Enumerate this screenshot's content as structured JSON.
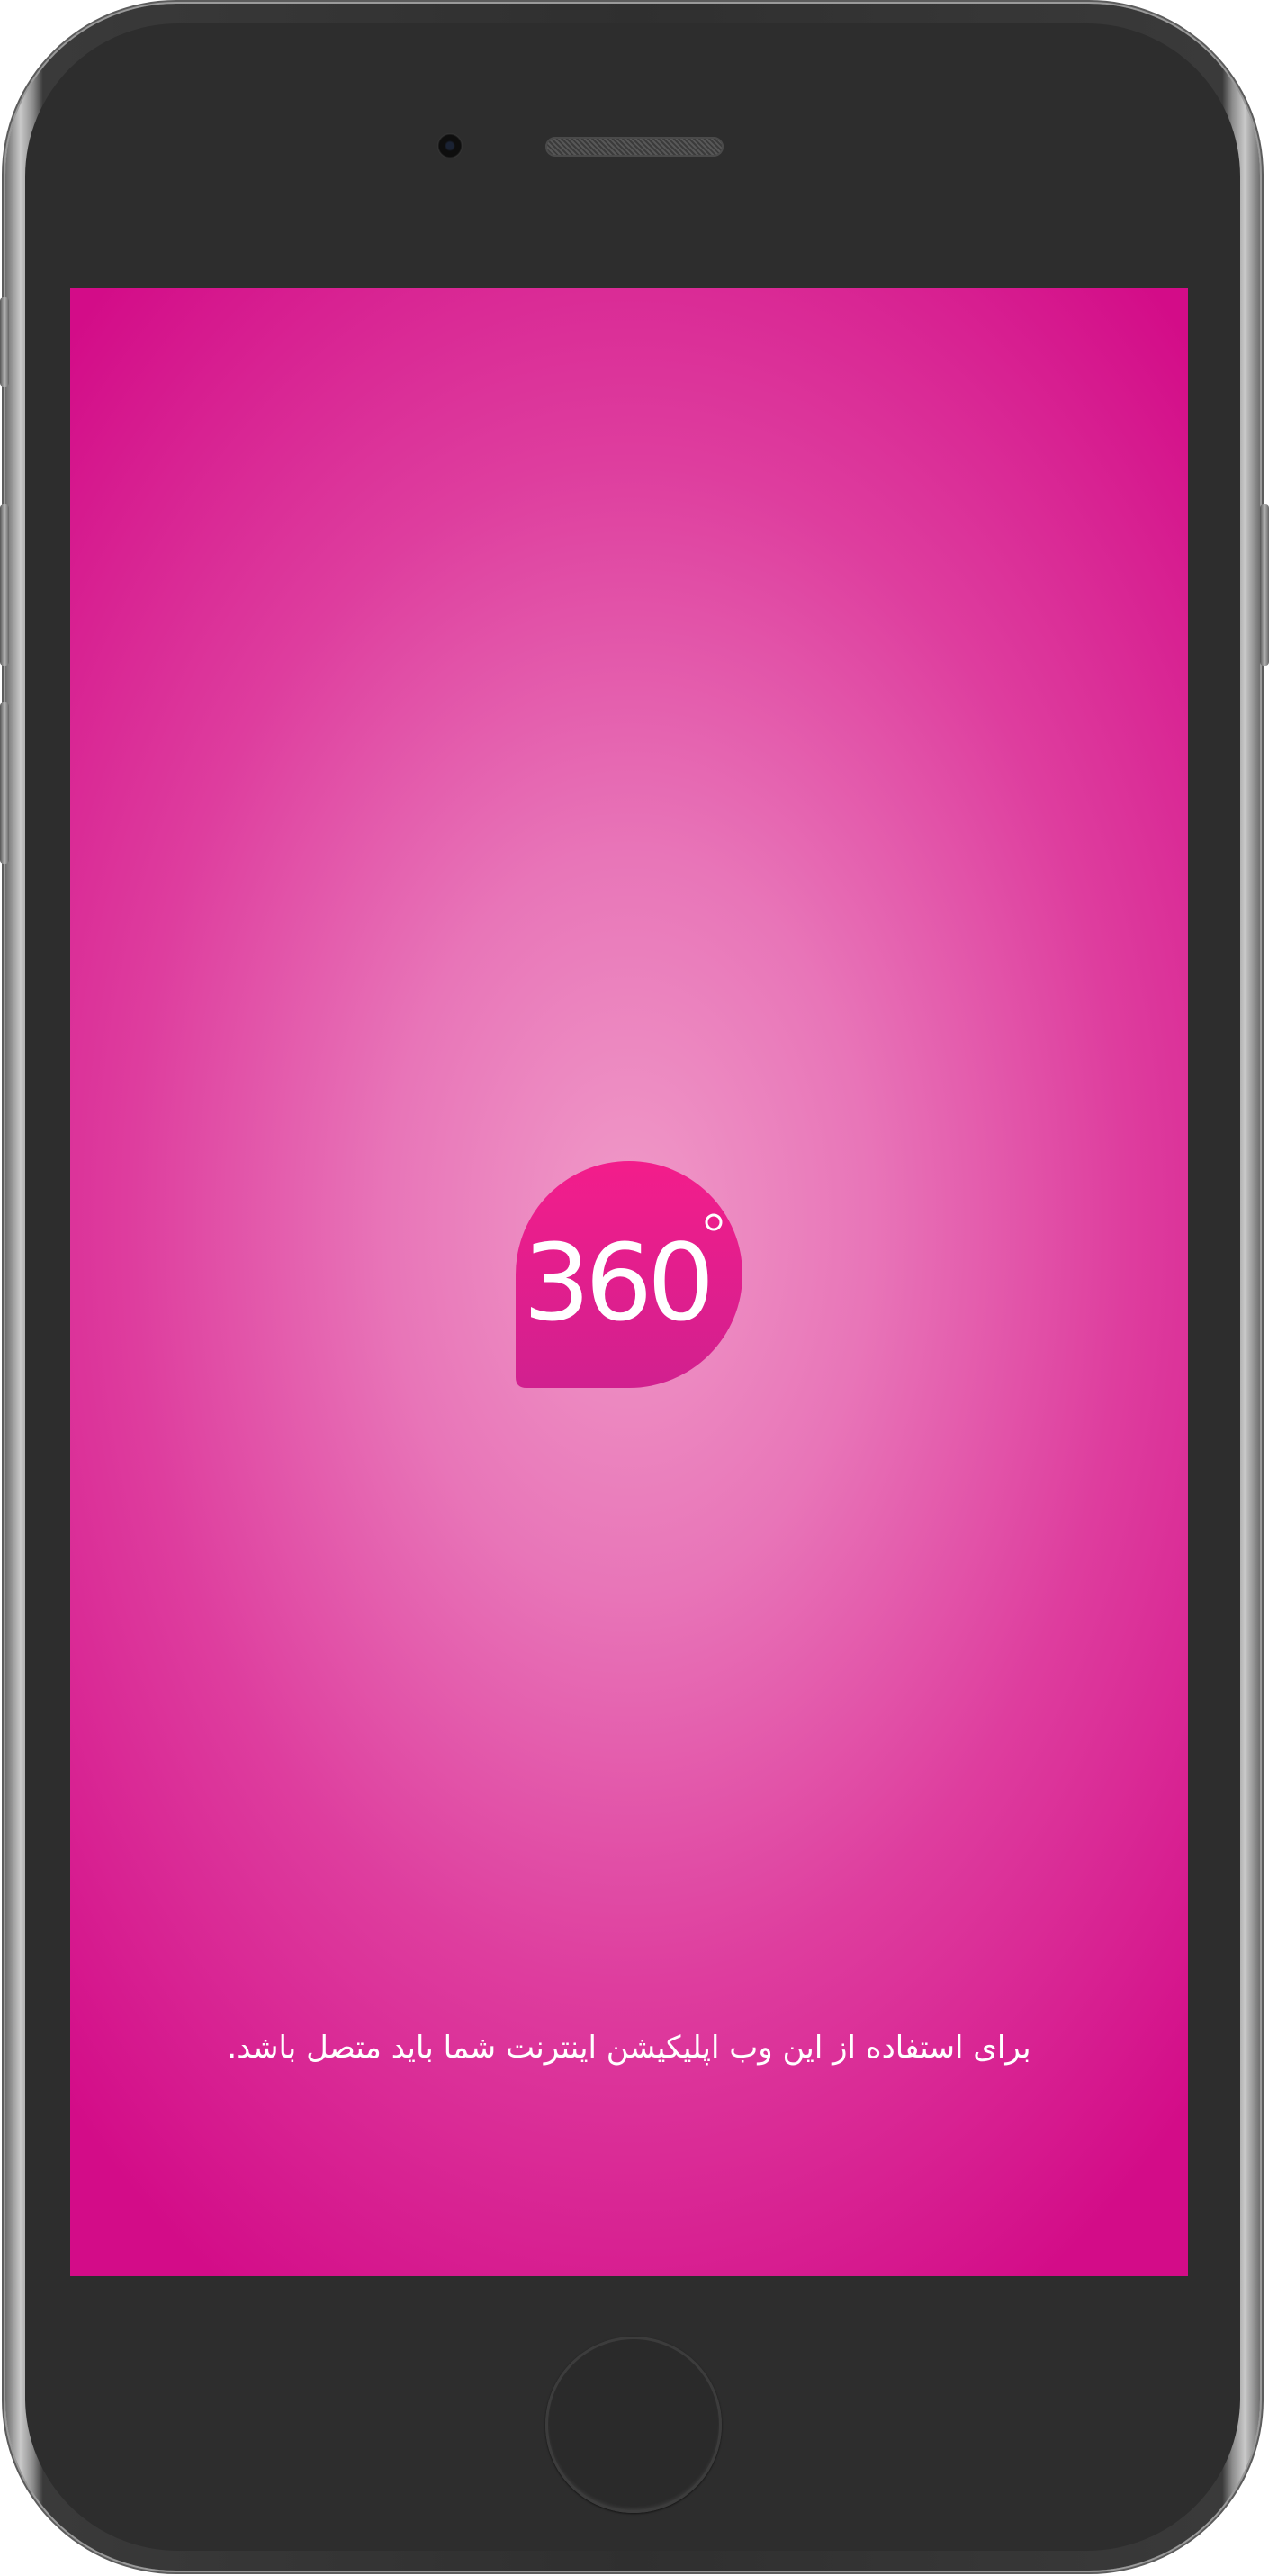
{
  "device": {
    "frame_color": "#2d2d2d",
    "screen_gradient_center": "#f09ac8",
    "screen_gradient_edge": "#d30c88"
  },
  "splash": {
    "logo_text": "360",
    "logo_color": "#e81f89",
    "message": "برای استفاده از این وب اپلیکیشن اینترنت شما باید متصل باشد."
  }
}
